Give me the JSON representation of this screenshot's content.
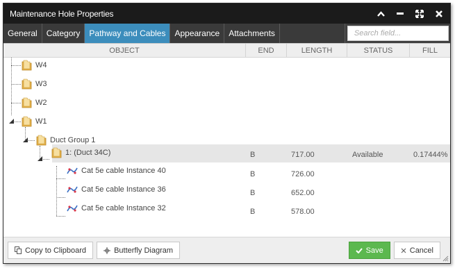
{
  "window": {
    "title": "Maintenance Hole Properties",
    "controls": [
      "collapse-icon",
      "minimize-icon",
      "maximize-icon",
      "close-icon"
    ]
  },
  "tabs": [
    {
      "label": "General",
      "active": false
    },
    {
      "label": "Category",
      "active": false
    },
    {
      "label": "Pathway and Cables",
      "active": true
    },
    {
      "label": "Appearance",
      "active": false
    },
    {
      "label": "Attachments",
      "active": false
    }
  ],
  "search": {
    "placeholder": "Search field...",
    "value": ""
  },
  "columns": {
    "object": "OBJECT",
    "end": "END",
    "length": "LENGTH",
    "status": "STATUS",
    "fill": "FILL"
  },
  "tree": {
    "w4": {
      "label": "W4",
      "icon": "folder-icon"
    },
    "w3": {
      "label": "W3",
      "icon": "folder-icon"
    },
    "w2": {
      "label": "W2",
      "icon": "folder-icon"
    },
    "w1": {
      "label": "W1",
      "icon": "folder-icon",
      "expanded": true
    },
    "duct_group": {
      "label": "Duct Group 1",
      "icon": "folder-icon",
      "expanded": true
    },
    "duct": {
      "label": "1: (Duct 34C)",
      "icon": "folder-icon",
      "expanded": true,
      "selected": true,
      "end": "B",
      "length": "717.00",
      "status": "Available",
      "fill": "0.17444%"
    },
    "cables": [
      {
        "label": "Cat 5e cable Instance 40",
        "icon": "cable-icon",
        "end": "B",
        "length": "726.00"
      },
      {
        "label": "Cat 5e cable Instance 36",
        "icon": "cable-icon",
        "end": "B",
        "length": "652.00"
      },
      {
        "label": "Cat 5e cable Instance 32",
        "icon": "cable-icon",
        "end": "B",
        "length": "578.00"
      }
    ]
  },
  "footer": {
    "copy_label": "Copy to Clipboard",
    "butterfly_label": "Butterfly Diagram",
    "save_label": "Save",
    "cancel_label": "Cancel"
  },
  "colors": {
    "active_tab": "#3c8dbc",
    "save_button": "#5cb84f",
    "titlebar": "#1b1b1b",
    "tabbar": "#3f3f3f"
  }
}
